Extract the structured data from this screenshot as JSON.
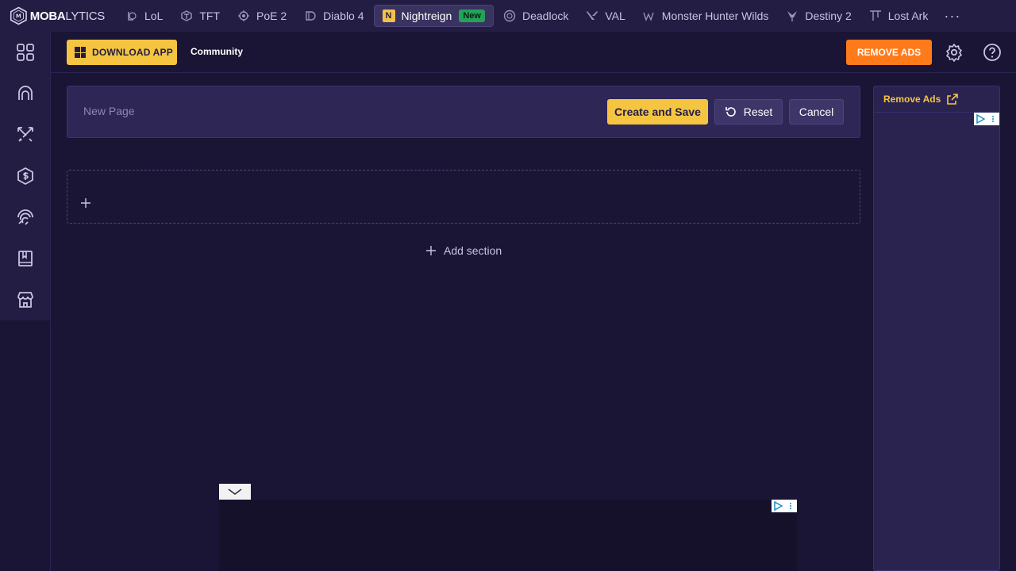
{
  "nav": {
    "logo_bold": "MOBA",
    "logo_thin": "LYTICS",
    "games": [
      {
        "label": "LoL",
        "icon": "lol-icon"
      },
      {
        "label": "TFT",
        "icon": "tft-icon"
      },
      {
        "label": "PoE 2",
        "icon": "poe2-icon"
      },
      {
        "label": "Diablo 4",
        "icon": "diablo4-icon"
      },
      {
        "label": "Nightreign",
        "icon": "nightreign-icon",
        "active": true,
        "badge": "New"
      },
      {
        "label": "Deadlock",
        "icon": "deadlock-icon"
      },
      {
        "label": "VAL",
        "icon": "valorant-icon"
      },
      {
        "label": "Monster Hunter Wilds",
        "icon": "monster-hunter-icon"
      },
      {
        "label": "Destiny 2",
        "icon": "destiny2-icon"
      },
      {
        "label": "Lost Ark",
        "icon": "lost-ark-icon"
      }
    ],
    "more": "···"
  },
  "header": {
    "download_label": "DOWNLOAD APP",
    "community_label": "Community",
    "remove_ads_label": "REMOVE ADS"
  },
  "editor": {
    "title_placeholder": "New Page",
    "create_save_label": "Create and Save",
    "reset_label": "Reset",
    "cancel_label": "Cancel",
    "add_section_label": "Add section"
  },
  "ad_panel": {
    "remove_ads_link": "Remove Ads"
  },
  "colors": {
    "background": "#1a1535",
    "nav": "#231d44",
    "accent_yellow": "#f5c542",
    "accent_orange": "#ff7a1a",
    "new_badge": "#22a35a"
  }
}
